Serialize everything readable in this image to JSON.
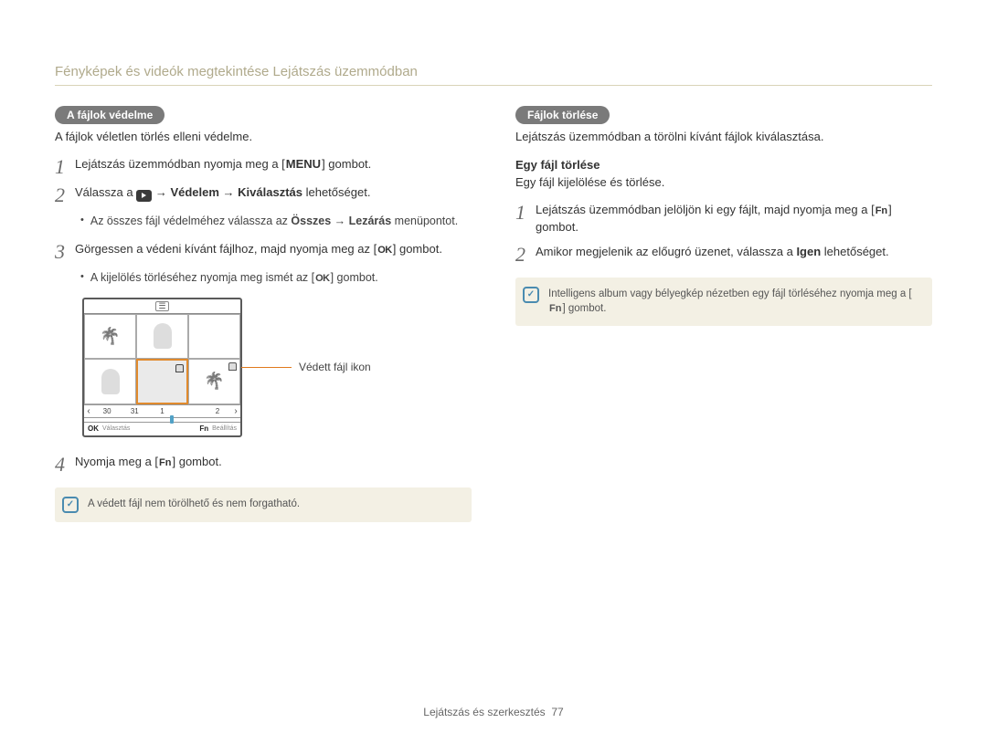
{
  "header": {
    "title": "Fényképek és videók megtekintése Lejátszás üzemmódban"
  },
  "left": {
    "section_pill": "A fájlok védelme",
    "desc": "A fájlok véletlen törlés elleni védelme.",
    "step1_a": "Lejátszás üzemmódban nyomja meg a [",
    "step1_key": "MENU",
    "step1_b": "] gombot.",
    "step2_a": "Válassza a ",
    "step2_b": " → ",
    "step2_c": "Védelem",
    "step2_d": " → ",
    "step2_e": "Kiválasztás",
    "step2_f": " lehetőséget.",
    "step2_bullet_a": "Az összes fájl védelméhez válassza az ",
    "step2_bullet_b": "Összes",
    "step2_bullet_c": " → ",
    "step2_bullet_d": "Lezárás",
    "step2_bullet_e": " menüpontot.",
    "step3_a": "Görgessen a védeni kívánt fájlhoz, majd nyomja meg az [",
    "step3_key": "OK",
    "step3_b": "] gombot.",
    "step3_bullet_a": "A kijelölés törléséhez nyomja meg ismét az [",
    "step3_bullet_key": "OK",
    "step3_bullet_b": "] gombot.",
    "diagram": {
      "calendar": [
        "30",
        "31",
        "1",
        "2"
      ],
      "ok_label": "Választás",
      "fn_label": "Beállítás",
      "ok_key": "OK",
      "fn_key": "Fn",
      "callout": "Védett fájl ikon"
    },
    "step4_a": "Nyomja meg a [",
    "step4_key": "Fn",
    "step4_b": "] gombot.",
    "note": "A védett fájl nem törölhető és nem forgatható."
  },
  "right": {
    "section_pill": "Fájlok törlése",
    "desc": "Lejátszás üzemmódban a törölni kívánt fájlok kiválasztása.",
    "subhead": "Egy fájl törlése",
    "subdesc": "Egy fájl kijelölése és törlése.",
    "step1_a": "Lejátszás üzemmódban jelöljön ki egy fájlt, majd nyomja meg a [",
    "step1_key": "Fn",
    "step1_b": "] gombot.",
    "step2_a": "Amikor megjelenik az előugró üzenet, válassza a ",
    "step2_b": "Igen",
    "step2_c": " lehetőséget.",
    "note_a": "Intelligens album vagy bélyegkép nézetben egy fájl törléséhez nyomja meg a [",
    "note_key": "Fn",
    "note_b": "] gombot."
  },
  "footer": {
    "section": "Lejátszás és szerkesztés",
    "page": "77"
  }
}
